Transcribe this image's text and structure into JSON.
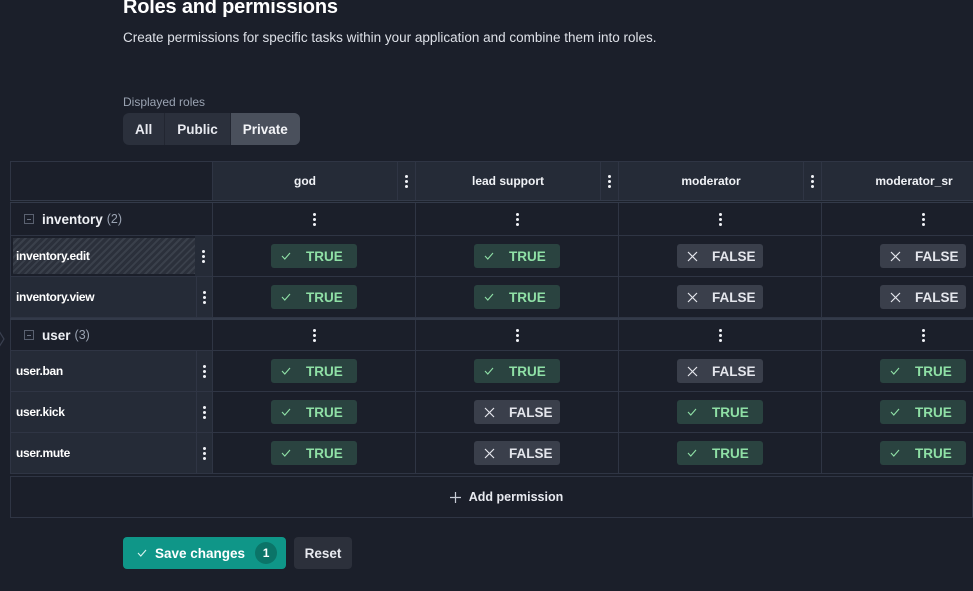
{
  "page": {
    "title": "Roles and permissions",
    "subtitle": "Create permissions for specific tasks within your application and combine them into roles."
  },
  "filter": {
    "label": "Displayed roles",
    "options": [
      "All",
      "Public",
      "Private"
    ],
    "selected": "Private"
  },
  "roles": [
    "god",
    "lead support",
    "moderator",
    "moderator_sr"
  ],
  "groups": [
    {
      "name": "inventory",
      "count": "(2)",
      "permissions": [
        {
          "name": "inventory.edit",
          "values": [
            "TRUE",
            "TRUE",
            "FALSE",
            "FALSE"
          ]
        },
        {
          "name": "inventory.view",
          "values": [
            "TRUE",
            "TRUE",
            "FALSE",
            "FALSE"
          ]
        }
      ]
    },
    {
      "name": "user",
      "count": "(3)",
      "permissions": [
        {
          "name": "user.ban",
          "values": [
            "TRUE",
            "TRUE",
            "FALSE",
            "TRUE"
          ]
        },
        {
          "name": "user.kick",
          "values": [
            "TRUE",
            "FALSE",
            "TRUE",
            "TRUE"
          ]
        },
        {
          "name": "user.mute",
          "values": [
            "TRUE",
            "FALSE",
            "TRUE",
            "TRUE"
          ]
        }
      ]
    }
  ],
  "table": {
    "add_permission_label": "Add permission"
  },
  "footer": {
    "save_label": "Save changes",
    "pending_count": "1",
    "reset_label": "Reset"
  },
  "icons": {
    "true": "check-icon",
    "false": "x-icon",
    "menu": "kebab-icon",
    "collapse": "collapse-icon",
    "add": "plus-icon"
  },
  "colors": {
    "accent": "#0f9688",
    "true_bg": "#2a4340",
    "true_text": "#8fe0a6",
    "false_bg": "#3a3f4b",
    "background": "#1b1f2a"
  }
}
